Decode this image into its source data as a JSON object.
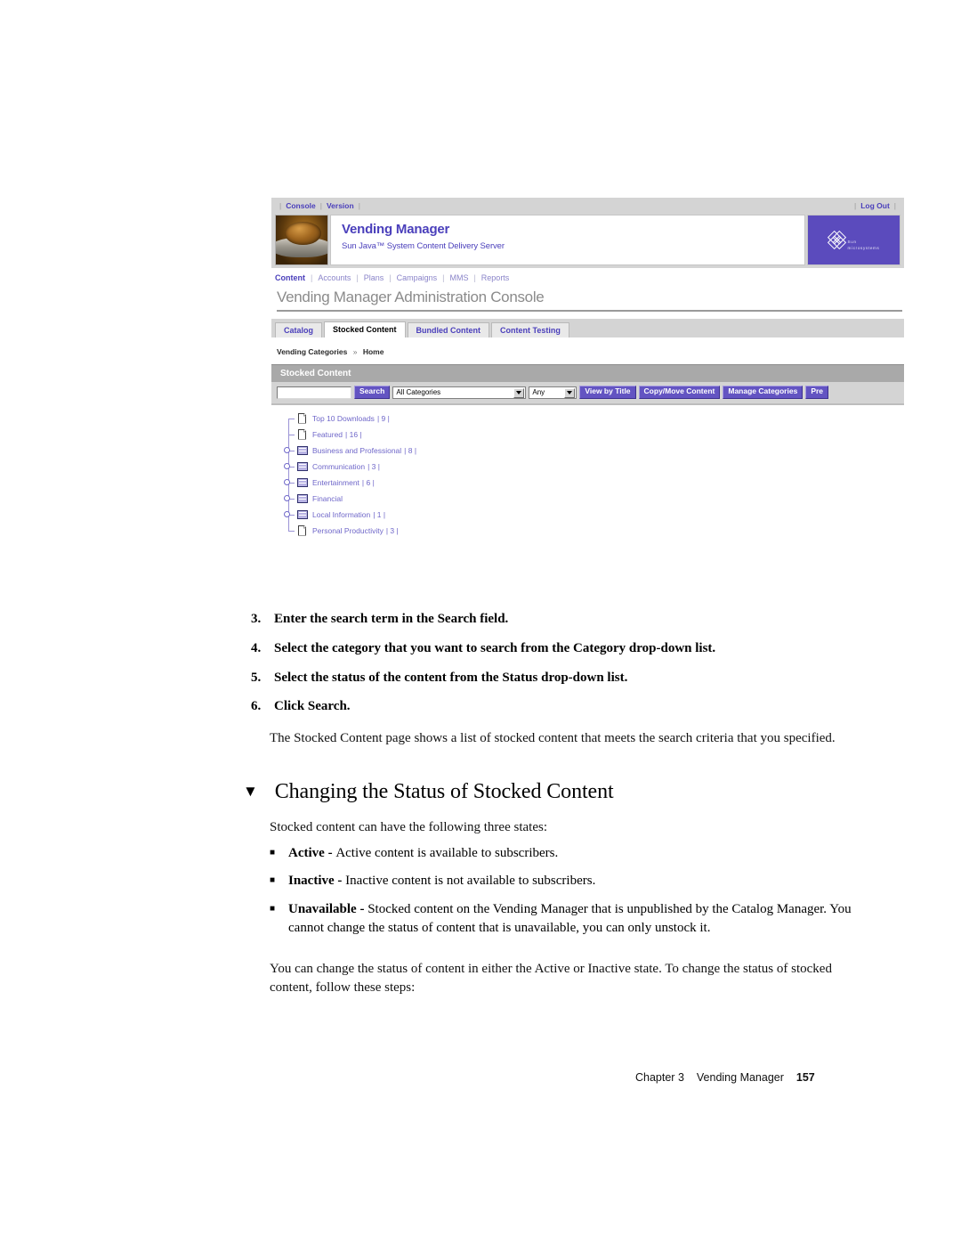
{
  "screenshot": {
    "util_bar": {
      "links": [
        "Console",
        "Version"
      ],
      "logout_label": "Log Out"
    },
    "masthead": {
      "title": "Vending Manager",
      "subtitle": "Sun Java™ System Content Delivery Server",
      "logo_wordmark": "Sun",
      "logo_tagline": "microsystems",
      "thumbnail_icon": "coins-photo-thumbnail"
    },
    "subnav": {
      "items": [
        "Content",
        "Accounts",
        "Plans",
        "Campaigns",
        "MMS",
        "Reports"
      ],
      "active": "Content",
      "separator": "|"
    },
    "console_title": "Vending Manager Administration Console",
    "tabs": [
      {
        "label": "Catalog",
        "active": false
      },
      {
        "label": "Stocked Content",
        "active": true
      },
      {
        "label": "Bundled Content",
        "active": false
      },
      {
        "label": "Content Testing",
        "active": false
      }
    ],
    "breadcrumb": {
      "root": "Vending Categories",
      "chevron": "»",
      "current": "Home"
    },
    "panel": {
      "title": "Stocked Content",
      "search_value": "",
      "search_placeholder": "",
      "search_button": "Search",
      "category_select": "All Categories",
      "status_select": "Any",
      "buttons": [
        "View by Title",
        "Copy/Move Content",
        "Manage Categories",
        "Pre"
      ]
    },
    "tree": [
      {
        "label": "Top 10 Downloads",
        "count": "| 9 |",
        "icon": "document-icon",
        "expandable": false
      },
      {
        "label": "Featured",
        "count": "| 16 |",
        "icon": "document-icon",
        "expandable": false
      },
      {
        "label": "Business and Professional",
        "count": "| 8 |",
        "icon": "folder-icon",
        "expandable": true
      },
      {
        "label": "Communication",
        "count": "| 3 |",
        "icon": "folder-icon",
        "expandable": true
      },
      {
        "label": "Entertainment",
        "count": "| 6 |",
        "icon": "folder-icon",
        "expandable": true
      },
      {
        "label": "Financial",
        "count": "",
        "icon": "folder-icon",
        "expandable": true
      },
      {
        "label": "Local Information",
        "count": "| 1 |",
        "icon": "folder-icon",
        "expandable": true
      },
      {
        "label": "Personal Productivity",
        "count": "| 3 |",
        "icon": "document-icon",
        "expandable": false
      }
    ],
    "colors": {
      "brand_purple": "#5b4bbd",
      "button_purple": "#6354c2",
      "link_purple": "#4a3fbb",
      "chrome_gray": "#d4d4d4",
      "panel_header_gray": "#a9a9a9"
    }
  },
  "document": {
    "steps": [
      {
        "num": "3.",
        "text": "Enter the search term in the Search field."
      },
      {
        "num": "4.",
        "text": "Select the category that you want to search from the Category drop-down list."
      },
      {
        "num": "5.",
        "text": "Select the status of the content from the Status drop-down list."
      },
      {
        "num": "6.",
        "text": "Click Search."
      }
    ],
    "para_result": "The Stocked Content page shows a list of stocked content that meets the search criteria that you specified.",
    "heading": {
      "marker": "▼",
      "text": "Changing the Status of Stocked Content"
    },
    "para_states": "Stocked content can have the following three states:",
    "bullets": [
      {
        "marker": "■",
        "term": "Active",
        "dash": " - ",
        "text": "Active content is available to subscribers."
      },
      {
        "marker": "■",
        "term": "Inactive",
        "dash": " - ",
        "text": "Inactive content is not available to subscribers."
      },
      {
        "marker": "■",
        "term": "Unavailable",
        "dash": " - ",
        "text": "Stocked content on the Vending Manager that is unpublished by the Catalog Manager. You cannot change the status of content that is unavailable, you can only unstock it."
      }
    ],
    "para_change": "You can change the status of content in either the Active or Inactive state. To change the status of stocked content, follow these steps:",
    "footer": {
      "chapter": "Chapter 3",
      "title": "Vending Manager",
      "page": "157"
    }
  }
}
